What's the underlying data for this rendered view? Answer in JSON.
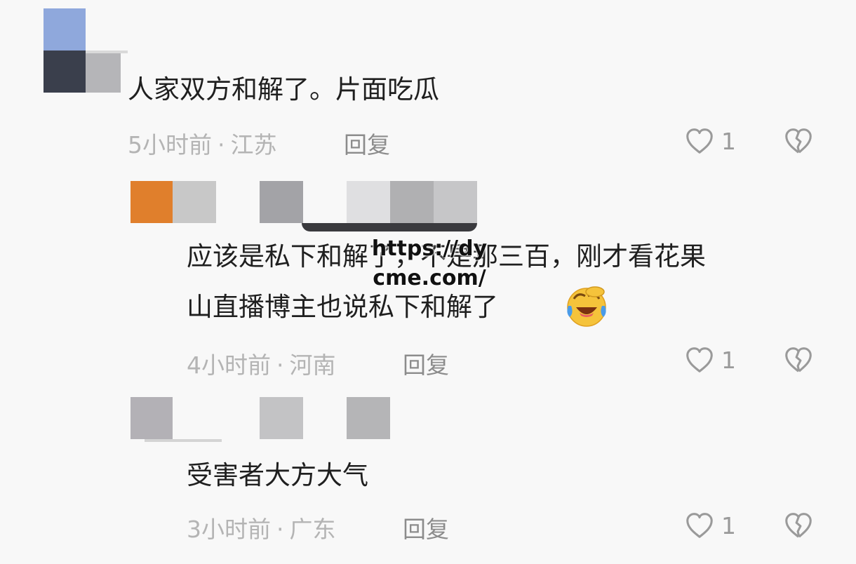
{
  "comments": [
    {
      "text": "人家双方和解了。片面吃瓜",
      "time": "5小时前",
      "separator": "·",
      "location": "江苏",
      "reply_label": "回复",
      "likes": "1"
    },
    {
      "text_line1": "应该是私下和解了，不是那三百，刚才看花果",
      "text_line2": "山直播博主也说私下和解了",
      "time": "4小时前",
      "separator": "·",
      "location": "河南",
      "reply_label": "回复",
      "likes": "1"
    },
    {
      "text": "受害者大方大气",
      "time": "3小时前",
      "separator": "·",
      "location": "广东",
      "reply_label": "回复",
      "likes": "1"
    }
  ],
  "watermark": {
    "line1": "https://dy",
    "line2": "cme.com/"
  },
  "icons": {
    "like": "heart-icon",
    "dislike": "broken-heart-icon",
    "emoji": "laughing-crying-emoji-icon"
  },
  "colors": {
    "background": "#f8f8f8",
    "meta_text": "#b4b4b4",
    "reply_text": "#8c8c8c",
    "icon_stroke": "#9a9a9a"
  }
}
